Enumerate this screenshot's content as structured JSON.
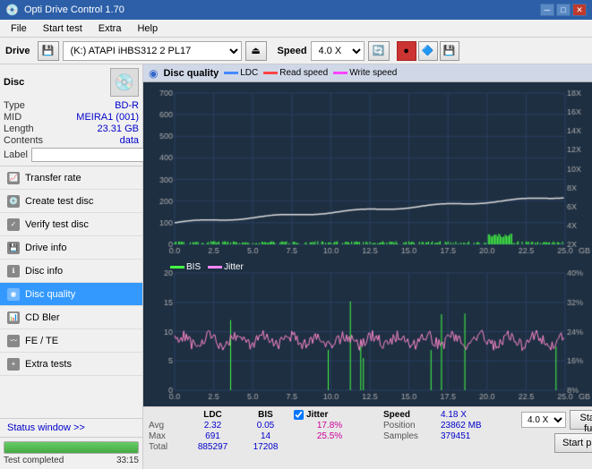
{
  "titleBar": {
    "title": "Opti Drive Control 1.70",
    "minBtn": "─",
    "maxBtn": "□",
    "closeBtn": "✕"
  },
  "menuBar": {
    "items": [
      "File",
      "Start test",
      "Extra",
      "Help"
    ]
  },
  "driveToolbar": {
    "driveLabel": "Drive",
    "driveValue": "(K:)  ATAPI iHBS312  2 PL17",
    "speedLabel": "Speed",
    "speedValue": "4.0 X"
  },
  "disc": {
    "title": "Disc",
    "typeLabel": "Type",
    "typeValue": "BD-R",
    "midLabel": "MID",
    "midValue": "MEIRA1 (001)",
    "lengthLabel": "Length",
    "lengthValue": "23.31 GB",
    "contentsLabel": "Contents",
    "contentsValue": "data",
    "labelLabel": "Label",
    "labelValue": ""
  },
  "navItems": [
    {
      "id": "transfer-rate",
      "label": "Transfer rate",
      "active": false
    },
    {
      "id": "create-test-disc",
      "label": "Create test disc",
      "active": false
    },
    {
      "id": "verify-test-disc",
      "label": "Verify test disc",
      "active": false
    },
    {
      "id": "drive-info",
      "label": "Drive info",
      "active": false
    },
    {
      "id": "disc-info",
      "label": "Disc info",
      "active": false
    },
    {
      "id": "disc-quality",
      "label": "Disc quality",
      "active": true
    },
    {
      "id": "cd-bler",
      "label": "CD Bler",
      "active": false
    },
    {
      "id": "fe-te",
      "label": "FE / TE",
      "active": false
    },
    {
      "id": "extra-tests",
      "label": "Extra tests",
      "active": false
    }
  ],
  "statusWindow": {
    "label": "Status window >>"
  },
  "progress": {
    "percent": 100,
    "statusText": "Test completed",
    "timeText": "33:15"
  },
  "chartPanel": {
    "title": "Disc quality",
    "legend": [
      {
        "id": "ldc",
        "label": "LDC",
        "color": "#4488ff"
      },
      {
        "id": "read-speed",
        "label": "Read speed",
        "color": "#ff4444"
      },
      {
        "id": "write-speed",
        "label": "Write speed",
        "color": "#ff44ff"
      }
    ],
    "legendBottom": [
      {
        "id": "bis",
        "label": "BIS",
        "color": "#44ff44"
      },
      {
        "id": "jitter",
        "label": "Jitter",
        "color": "#ff88ff"
      }
    ]
  },
  "stats": {
    "avgLabel": "Avg",
    "maxLabel": "Max",
    "totalLabel": "Total",
    "ldcAvg": "2.32",
    "ldcMax": "691",
    "ldcTotal": "885297",
    "bisAvg": "0.05",
    "bisMax": "14",
    "bisTotal": "17208",
    "jitterLabel": "Jitter",
    "jitterAvg": "17.8%",
    "jitterMax": "25.5%",
    "speedLabel": "Speed",
    "speedAvg": "4.18 X",
    "positionLabel": "Position",
    "positionValue": "23862 MB",
    "samplesLabel": "Samples",
    "samplesValue": "379451",
    "speedDropdown": "4.0 X",
    "startFullBtn": "Start full",
    "startPartBtn": "Start part",
    "ldcHeader": "LDC",
    "bisHeader": "BIS"
  }
}
